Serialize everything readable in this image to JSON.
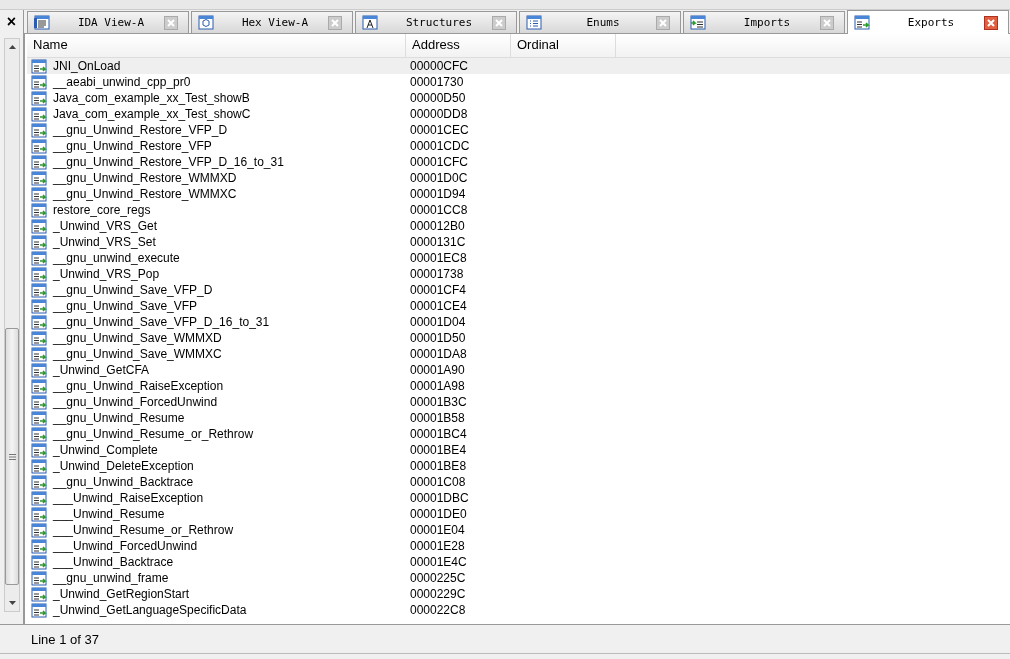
{
  "side_panel": {
    "close": "×"
  },
  "tabs": [
    {
      "label": "IDA View-A",
      "kind": "ida-view",
      "selected": false
    },
    {
      "label": "Hex View-A",
      "kind": "hex",
      "selected": false
    },
    {
      "label": "Structures",
      "kind": "structures",
      "selected": false
    },
    {
      "label": "Enums",
      "kind": "enums",
      "selected": false
    },
    {
      "label": "Imports",
      "kind": "imports",
      "selected": false
    },
    {
      "label": "Exports",
      "kind": "exports",
      "selected": true
    }
  ],
  "table": {
    "columns": [
      "Name",
      "Address",
      "Ordinal"
    ],
    "rows": [
      {
        "name": "JNI_OnLoad",
        "address": "00000CFC",
        "selected": true
      },
      {
        "name": "__aeabi_unwind_cpp_pr0",
        "address": "00001730",
        "selected": false
      },
      {
        "name": "Java_com_example_xx_Test_showB",
        "address": "00000D50",
        "selected": false
      },
      {
        "name": "Java_com_example_xx_Test_showC",
        "address": "00000DD8",
        "selected": false
      },
      {
        "name": "__gnu_Unwind_Restore_VFP_D",
        "address": "00001CEC",
        "selected": false
      },
      {
        "name": "__gnu_Unwind_Restore_VFP",
        "address": "00001CDC",
        "selected": false
      },
      {
        "name": "__gnu_Unwind_Restore_VFP_D_16_to_31",
        "address": "00001CFC",
        "selected": false
      },
      {
        "name": "__gnu_Unwind_Restore_WMMXD",
        "address": "00001D0C",
        "selected": false
      },
      {
        "name": "__gnu_Unwind_Restore_WMMXC",
        "address": "00001D94",
        "selected": false
      },
      {
        "name": "restore_core_regs",
        "address": "00001CC8",
        "selected": false
      },
      {
        "name": "_Unwind_VRS_Get",
        "address": "000012B0",
        "selected": false
      },
      {
        "name": "_Unwind_VRS_Set",
        "address": "0000131C",
        "selected": false
      },
      {
        "name": "__gnu_unwind_execute",
        "address": "00001EC8",
        "selected": false
      },
      {
        "name": "_Unwind_VRS_Pop",
        "address": "00001738",
        "selected": false
      },
      {
        "name": "__gnu_Unwind_Save_VFP_D",
        "address": "00001CF4",
        "selected": false
      },
      {
        "name": "__gnu_Unwind_Save_VFP",
        "address": "00001CE4",
        "selected": false
      },
      {
        "name": "__gnu_Unwind_Save_VFP_D_16_to_31",
        "address": "00001D04",
        "selected": false
      },
      {
        "name": "__gnu_Unwind_Save_WMMXD",
        "address": "00001D50",
        "selected": false
      },
      {
        "name": "__gnu_Unwind_Save_WMMXC",
        "address": "00001DA8",
        "selected": false
      },
      {
        "name": "_Unwind_GetCFA",
        "address": "00001A90",
        "selected": false
      },
      {
        "name": "__gnu_Unwind_RaiseException",
        "address": "00001A98",
        "selected": false
      },
      {
        "name": "__gnu_Unwind_ForcedUnwind",
        "address": "00001B3C",
        "selected": false
      },
      {
        "name": "__gnu_Unwind_Resume",
        "address": "00001B58",
        "selected": false
      },
      {
        "name": "__gnu_Unwind_Resume_or_Rethrow",
        "address": "00001BC4",
        "selected": false
      },
      {
        "name": "_Unwind_Complete",
        "address": "00001BE4",
        "selected": false
      },
      {
        "name": "_Unwind_DeleteException",
        "address": "00001BE8",
        "selected": false
      },
      {
        "name": "__gnu_Unwind_Backtrace",
        "address": "00001C08",
        "selected": false
      },
      {
        "name": "___Unwind_RaiseException",
        "address": "00001DBC",
        "selected": false
      },
      {
        "name": "___Unwind_Resume",
        "address": "00001DE0",
        "selected": false
      },
      {
        "name": "___Unwind_Resume_or_Rethrow",
        "address": "00001E04",
        "selected": false
      },
      {
        "name": "___Unwind_ForcedUnwind",
        "address": "00001E28",
        "selected": false
      },
      {
        "name": "___Unwind_Backtrace",
        "address": "00001E4C",
        "selected": false
      },
      {
        "name": "__gnu_unwind_frame",
        "address": "0000225C",
        "selected": false
      },
      {
        "name": "_Unwind_GetRegionStart",
        "address": "0000229C",
        "selected": false
      },
      {
        "name": "_Unwind_GetLanguageSpecificData",
        "address": "000022C8",
        "selected": false
      }
    ]
  },
  "status_bar": {
    "text": "Line 1 of 37"
  }
}
